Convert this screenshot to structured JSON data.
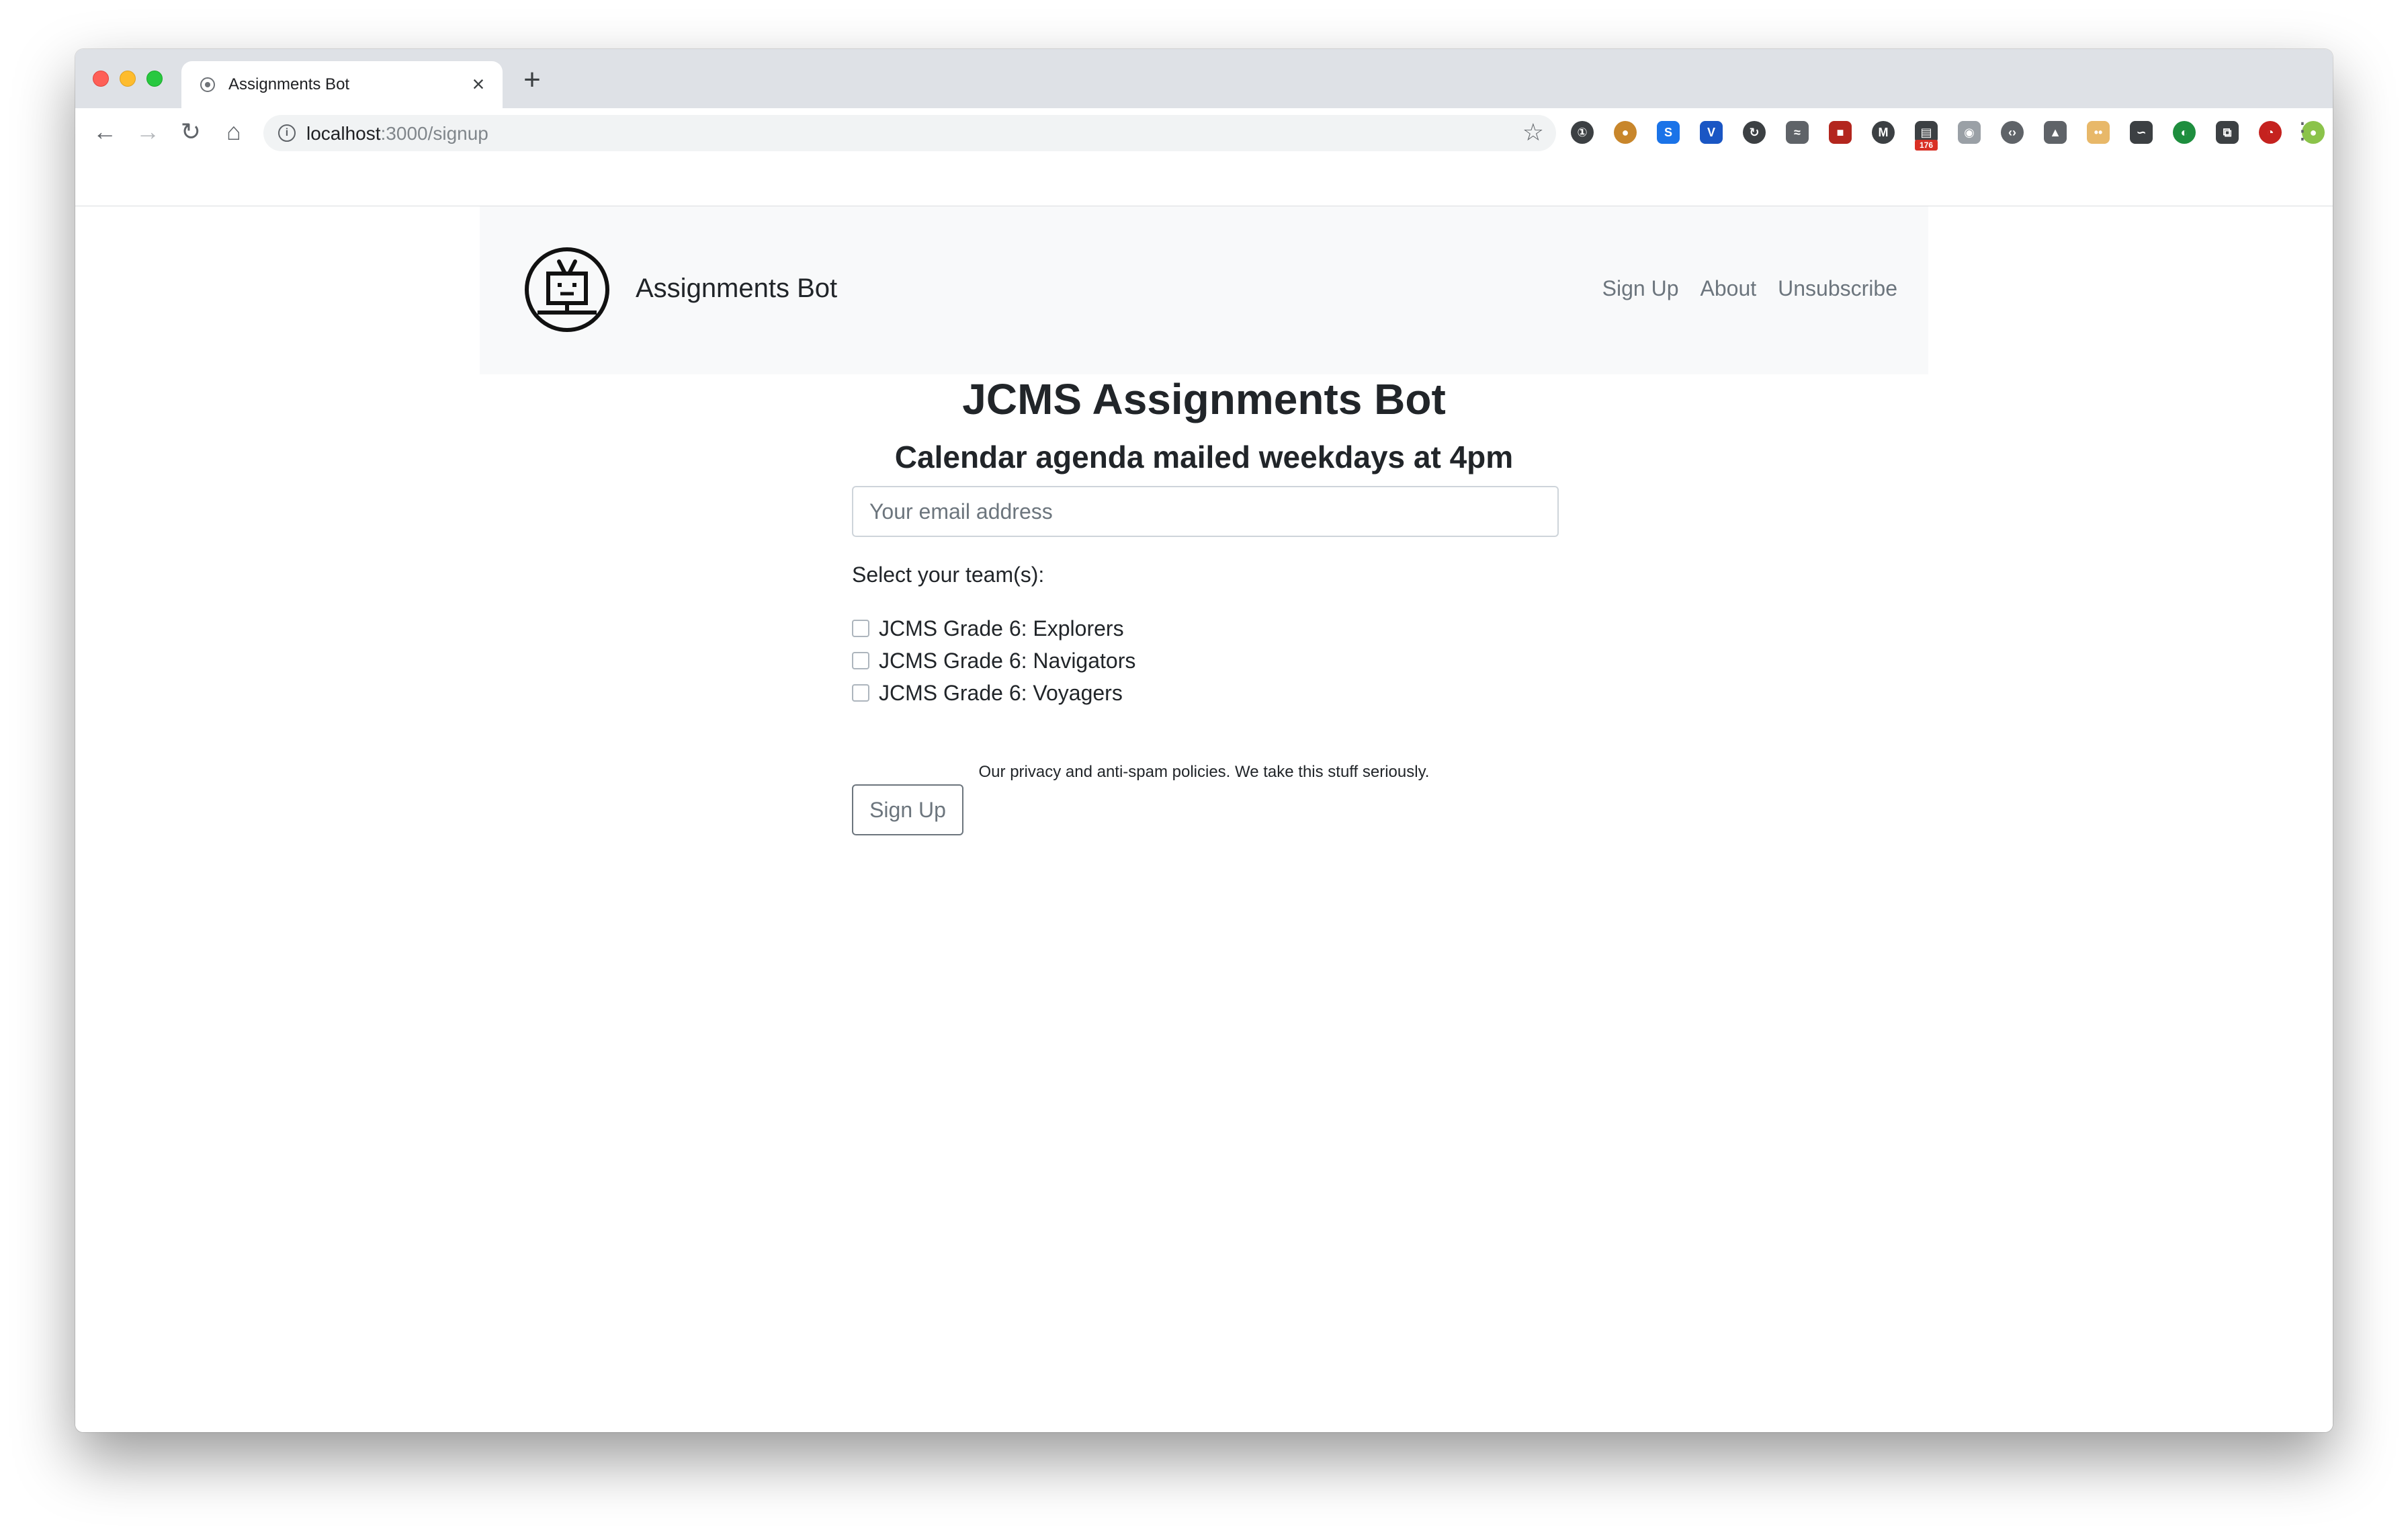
{
  "browser": {
    "tab_title": "Assignments Bot",
    "tab_close": "×",
    "new_tab": "+",
    "url_host": "localhost",
    "url_path": ":3000/signup",
    "nav_icons": {
      "back": "←",
      "forward": "→",
      "reload": "↻",
      "home": "⌂"
    },
    "bookmark_icon": "☆",
    "menu_icon": "⋮",
    "extensions": [
      {
        "name": "1password-icon",
        "glyph": "①",
        "color": "#3c4043",
        "round": true
      },
      {
        "name": "cookie-icon",
        "glyph": "●",
        "color": "#c8862b",
        "round": true
      },
      {
        "name": "s-extension-icon",
        "glyph": "S",
        "color": "#1a73e8",
        "round": false
      },
      {
        "name": "v-extension-icon",
        "glyph": "V",
        "color": "#1a56c4",
        "round": false
      },
      {
        "name": "sync-icon",
        "glyph": "↻",
        "color": "#3c4043",
        "round": true
      },
      {
        "name": "shoe-icon",
        "glyph": "≈",
        "color": "#5f6368",
        "round": false
      },
      {
        "name": "red-extension-icon",
        "glyph": "■",
        "color": "#b3261e",
        "round": false
      },
      {
        "name": "m-extension-icon",
        "glyph": "M",
        "color": "#3c4043",
        "round": true
      },
      {
        "name": "calendar-badge-icon",
        "glyph": "▤",
        "color": "#3c4043",
        "round": false,
        "badge": true
      },
      {
        "name": "camera-icon",
        "glyph": "◉",
        "color": "#9aa0a6",
        "round": false
      },
      {
        "name": "code-icon",
        "glyph": "‹›",
        "color": "#5f6368",
        "round": true
      },
      {
        "name": "drive-icon",
        "glyph": "▲",
        "color": "#5f6368",
        "round": false
      },
      {
        "name": "face-extension-icon",
        "glyph": "••",
        "color": "#e8b869",
        "round": false
      },
      {
        "name": "swirl-icon",
        "glyph": "∽",
        "color": "#3c4043",
        "round": false
      },
      {
        "name": "green-extension-icon",
        "glyph": "◐",
        "color": "#1e8e3e",
        "round": true
      },
      {
        "name": "copy-icon",
        "glyph": "⧉",
        "color": "#3c4043",
        "round": false
      },
      {
        "name": "red-circle-icon",
        "glyph": "◔",
        "color": "#c5221f",
        "round": true
      },
      {
        "name": "profile-avatar-icon",
        "glyph": "●",
        "color": "#8bc34a",
        "round": true
      }
    ]
  },
  "navbar": {
    "brand": "Assignments Bot",
    "links": [
      "Sign Up",
      "About",
      "Unsubscribe"
    ]
  },
  "main": {
    "title": "JCMS Assignments Bot",
    "subtitle": "Calendar agenda mailed weekdays at 4pm",
    "email_placeholder": "Your email address",
    "team_label": "Select your team(s):",
    "teams": [
      "JCMS Grade 6: Explorers",
      "JCMS Grade 6: Navigators",
      "JCMS Grade 6: Voyagers"
    ],
    "submit_label": "Sign Up",
    "privacy_text": "Our privacy and anti-spam policies. We take this stuff seriously."
  }
}
